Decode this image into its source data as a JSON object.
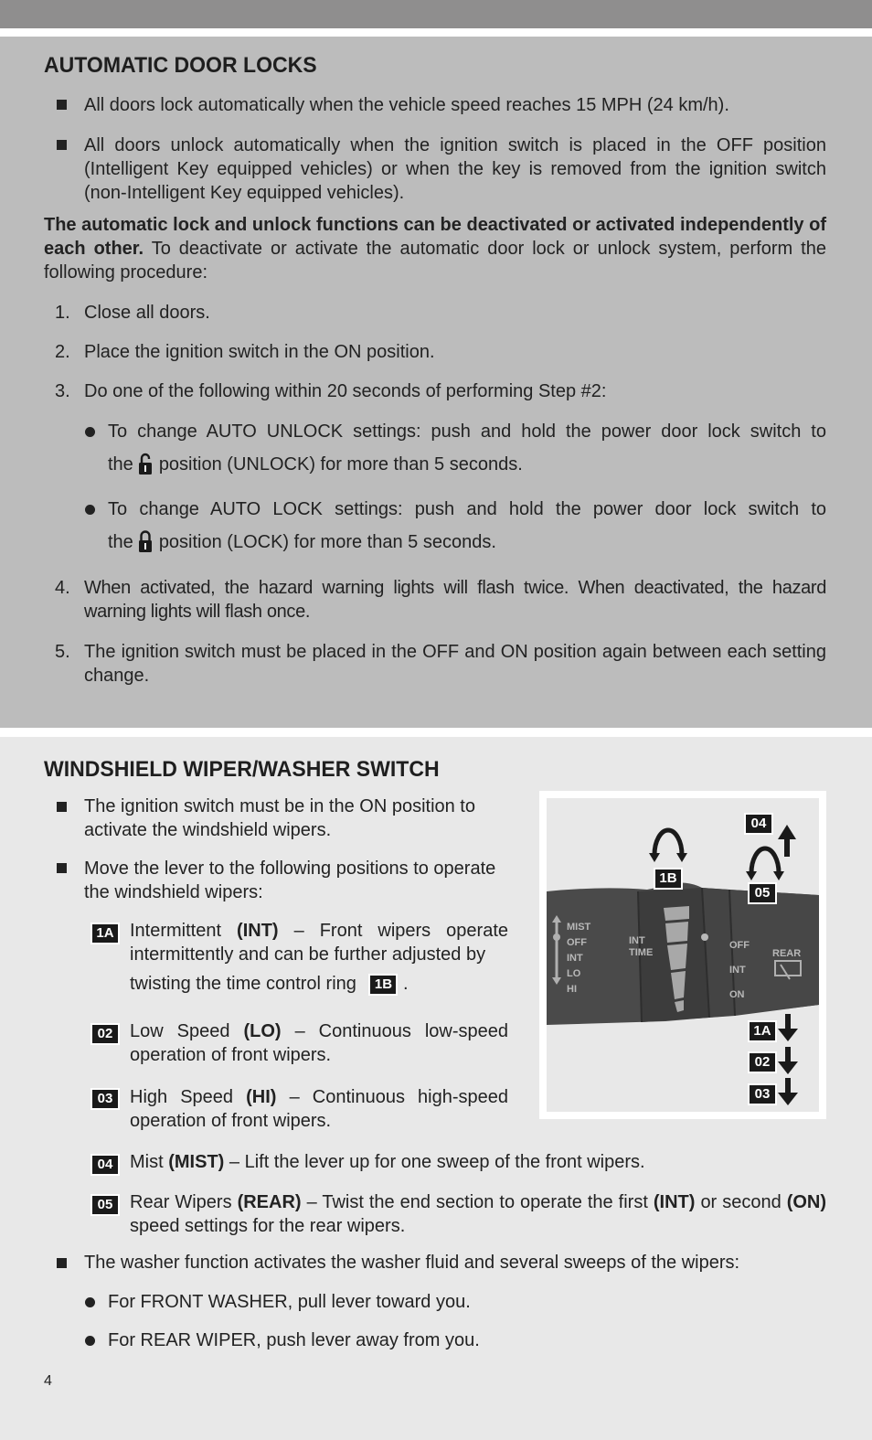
{
  "section1": {
    "title": "AUTOMATIC DOOR LOCKS",
    "bullets": [
      "All doors lock automatically when the vehicle speed reaches 15 MPH (24 km/h).",
      "All doors unlock automatically when the ignition switch is placed in the OFF position (Intelligent Key equipped vehicles) or when the key is removed from the ignition switch (non-Intelligent Key equipped vehicles)."
    ],
    "intro_bold": "The automatic lock and unlock functions can be deactivated or activated independently of each other.",
    "intro_rest": "To deactivate or activate the automatic door lock or unlock system, perform the following procedure:",
    "steps": [
      {
        "num": "1.",
        "text": "Close all doors."
      },
      {
        "num": "2.",
        "text": "Place the ignition switch in the ON position."
      },
      {
        "num": "3.",
        "text": "Do one of the following within 20 seconds of performing Step #2:"
      },
      {
        "num": "4.",
        "text": "When activated, the hazard warning lights will flash twice. When deactivated, the hazard warning lights will flash once."
      },
      {
        "num": "5.",
        "text": "The ignition switch must be placed in the OFF and ON position again between each setting change."
      }
    ],
    "sub_bullets": [
      {
        "line1": "To change AUTO UNLOCK settings: push and hold the power door lock switch to",
        "pre": "the",
        "icon": "unlock-icon",
        "post": "position (UNLOCK) for more than 5 seconds."
      },
      {
        "line1": "To change AUTO LOCK settings: push and hold the power door lock switch to",
        "pre": "the",
        "icon": "lock-icon",
        "post": "position (LOCK) for more than 5 seconds."
      }
    ]
  },
  "section2": {
    "title": "WINDSHIELD WIPER/WASHER SWITCH",
    "bullets": [
      "The ignition switch must be in the ON position to activate the windshield wipers.",
      "Move the lever to the following positions to operate the windshield wipers:",
      "The washer function activates the washer fluid and several sweeps of the wipers:"
    ],
    "items": [
      {
        "badge": "1A",
        "label": "Intermittent",
        "bold": "(INT)",
        "text": "– Front wipers operate intermittently and can be further adjusted by",
        "line3": "twisting the time control ring",
        "ref_badge": "1B",
        "tail": "."
      },
      {
        "badge": "02",
        "label": "Low Speed",
        "bold": "(LO)",
        "text": "– Continuous low-speed operation of front wipers."
      },
      {
        "badge": "03",
        "label": "High Speed",
        "bold": "(HI)",
        "text": "– Continuous high-speed operation of front wipers."
      },
      {
        "badge": "04",
        "label": "Mist",
        "bold": "(MIST)",
        "text": "– Lift the lever up for one sweep of the front wipers."
      },
      {
        "badge": "05",
        "label": "Rear Wipers",
        "bold": "(REAR)",
        "text": "– Twist the end section to operate the first",
        "bold2": "(INT)",
        "text2": "or second",
        "bold3": "(ON)",
        "text3": "speed settings for the rear wipers."
      }
    ],
    "washer_bullets": [
      "For FRONT WASHER, pull lever toward you.",
      "For REAR WIPER, push lever away from you."
    ],
    "figure": {
      "badges": [
        "04",
        "1B",
        "05",
        "1A",
        "02",
        "03"
      ],
      "lever_left_labels": [
        "MIST",
        "OFF",
        "INT",
        "LO",
        "HI"
      ],
      "ring_labels": [
        "INT",
        "TIME"
      ],
      "rear_labels": [
        "OFF",
        "INT",
        "ON"
      ],
      "rear_title": "REAR"
    }
  },
  "page_number": "4"
}
